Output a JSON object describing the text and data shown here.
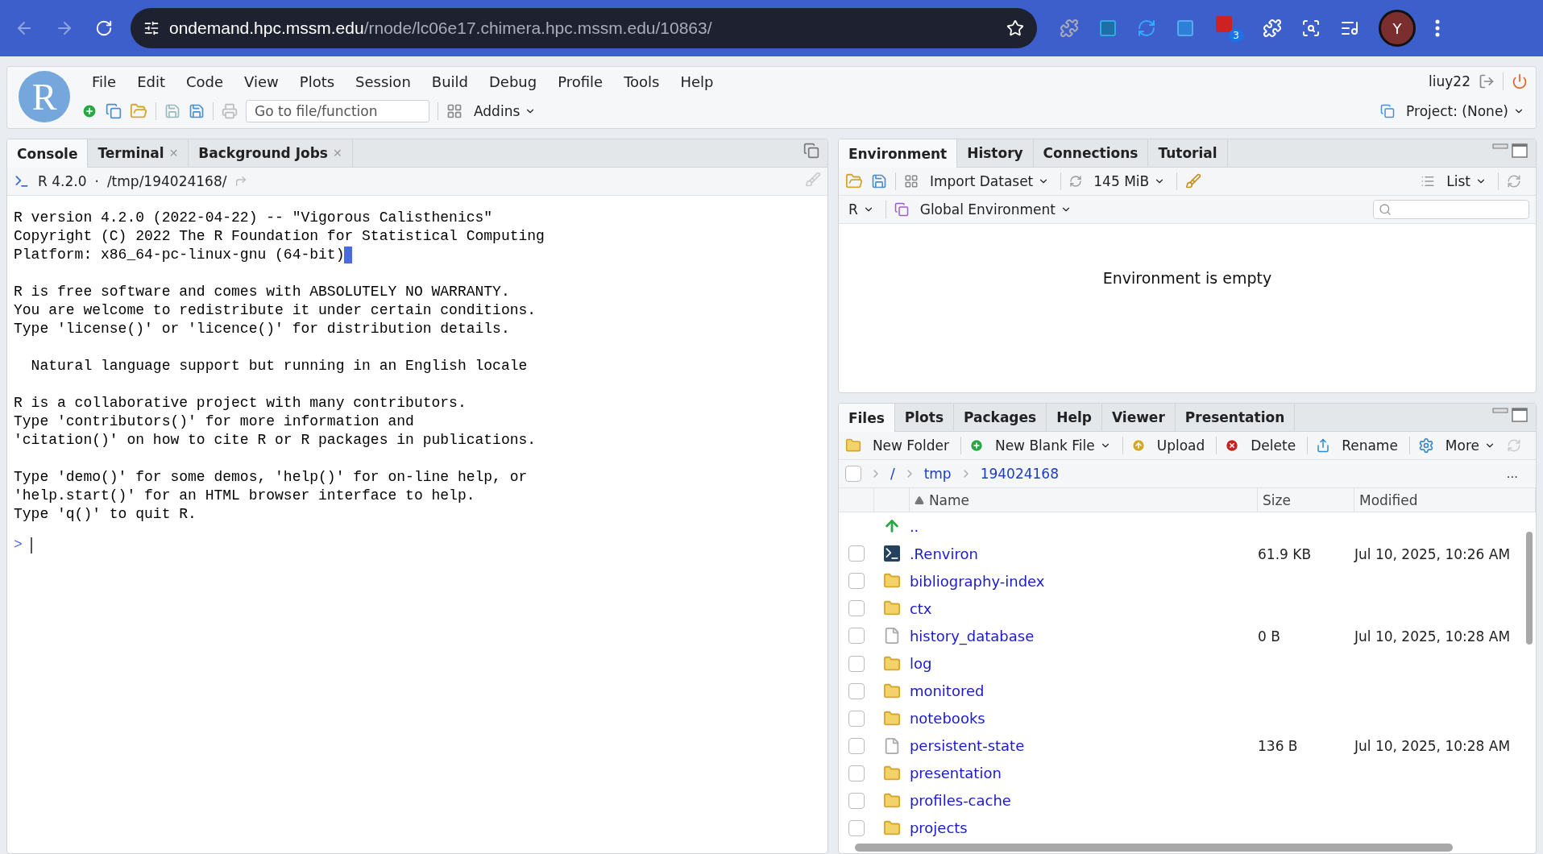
{
  "browser": {
    "url_host": "ondemand.hpc.mssm.edu",
    "url_path": "/rnode/lc06e17.chimera.hpc.mssm.edu/10863/",
    "extension_badge": "3",
    "avatar": "Y"
  },
  "menu": {
    "logo": "R",
    "items": [
      "File",
      "Edit",
      "Code",
      "View",
      "Plots",
      "Session",
      "Build",
      "Debug",
      "Profile",
      "Tools",
      "Help"
    ],
    "user": "liuy22"
  },
  "toolbar": {
    "goto_placeholder": "Go to file/function",
    "addins": "Addins",
    "project": "Project: (None)"
  },
  "console": {
    "tabs": [
      {
        "label": "Console",
        "selected": true
      },
      {
        "label": "Terminal",
        "selected": false,
        "close": "✕"
      },
      {
        "label": "Background Jobs",
        "selected": false,
        "close": "✕"
      }
    ],
    "version": "R 4.2.0",
    "separator": "·",
    "path": "/tmp/194024168/",
    "paragraphs": [
      {
        "cursor": true,
        "lines": [
          "R version 4.2.0 (2022-04-22) -- \"Vigorous Calisthenics\"",
          "Copyright (C) 2022 The R Foundation for Statistical Computing",
          "Platform: x86_64-pc-linux-gnu (64-bit)"
        ]
      },
      {
        "cursor": false,
        "lines": [
          "R is free software and comes with ABSOLUTELY NO WARRANTY.",
          "You are welcome to redistribute it under certain conditions.",
          "Type 'license()' or 'licence()' for distribution details."
        ]
      },
      {
        "cursor": false,
        "lines": [
          "  Natural language support but running in an English locale"
        ]
      },
      {
        "cursor": false,
        "lines": [
          "R is a collaborative project with many contributors.",
          "Type 'contributors()' for more information and",
          "'citation()' on how to cite R or R packages in publications."
        ]
      },
      {
        "cursor": false,
        "lines": [
          "Type 'demo()' for some demos, 'help()' for on-line help, or",
          "'help.start()' for an HTML browser interface to help.",
          "Type 'q()' to quit R."
        ]
      }
    ],
    "prompt": ">"
  },
  "environment": {
    "tabs": [
      {
        "label": "Environment",
        "selected": true
      },
      {
        "label": "History",
        "selected": false
      },
      {
        "label": "Connections",
        "selected": false
      },
      {
        "label": "Tutorial",
        "selected": false
      }
    ],
    "import": "Import Dataset",
    "memory": "145 MiB",
    "view": "List",
    "language": "R",
    "scope": "Global Environment",
    "empty_message": "Environment is empty"
  },
  "files": {
    "tabs": [
      {
        "label": "Files",
        "selected": true
      },
      {
        "label": "Plots",
        "selected": false
      },
      {
        "label": "Packages",
        "selected": false
      },
      {
        "label": "Help",
        "selected": false
      },
      {
        "label": "Viewer",
        "selected": false
      },
      {
        "label": "Presentation",
        "selected": false
      }
    ],
    "actions": [
      {
        "label": "New Folder",
        "kind": "folder",
        "menu": false
      },
      {
        "label": "New Blank File",
        "kind": "add",
        "menu": true
      },
      {
        "label": "Upload",
        "kind": "upload",
        "menu": false
      },
      {
        "label": "Delete",
        "kind": "delete",
        "menu": false
      },
      {
        "label": "Rename",
        "kind": "rename",
        "menu": false
      },
      {
        "label": "More",
        "kind": "gear",
        "menu": true
      }
    ],
    "select_all_checked": false,
    "breadcrumb": [
      "/",
      "tmp",
      "194024168"
    ],
    "more": "...",
    "columns": [
      "Name",
      "Size",
      "Modified"
    ],
    "rows": [
      {
        "name": "..",
        "kind": "up"
      },
      {
        "name": ".Renviron",
        "kind": "script",
        "size": "61.9 KB",
        "modified": "Jul 10, 2025, 10:26 AM",
        "checked": false
      },
      {
        "name": "bibliography-index",
        "kind": "folder",
        "checked": false
      },
      {
        "name": "ctx",
        "kind": "folder",
        "checked": false
      },
      {
        "name": "history_database",
        "kind": "file",
        "size": "0 B",
        "modified": "Jul 10, 2025, 10:28 AM",
        "checked": false
      },
      {
        "name": "log",
        "kind": "folder",
        "checked": false
      },
      {
        "name": "monitored",
        "kind": "folder",
        "checked": false
      },
      {
        "name": "notebooks",
        "kind": "folder",
        "checked": false
      },
      {
        "name": "persistent-state",
        "kind": "file",
        "size": "136 B",
        "modified": "Jul 10, 2025, 10:28 AM",
        "checked": false
      },
      {
        "name": "presentation",
        "kind": "folder",
        "checked": false
      },
      {
        "name": "profiles-cache",
        "kind": "folder",
        "checked": false
      },
      {
        "name": "projects",
        "kind": "folder",
        "checked": false
      }
    ]
  }
}
